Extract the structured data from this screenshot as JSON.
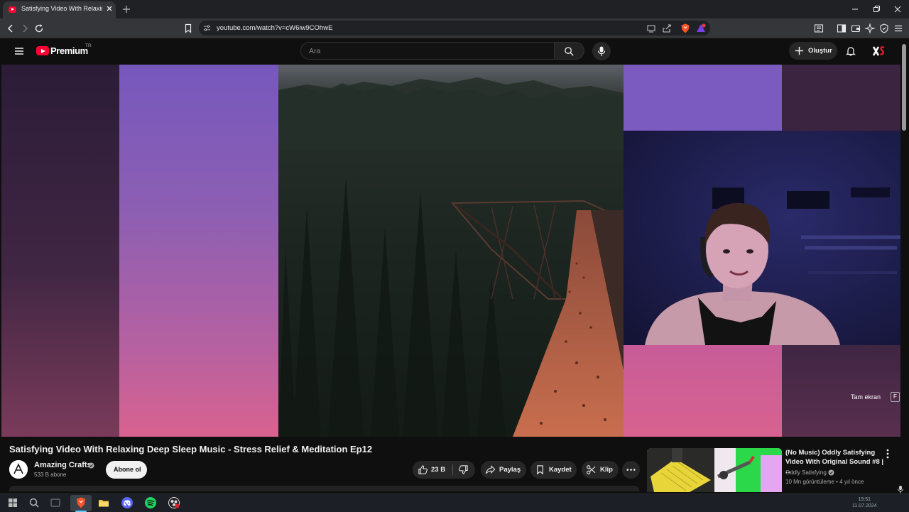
{
  "browser": {
    "tab_title": "Satisfying Video With Relaxing D",
    "url": "youtube.com/watch?v=cW6iw9COhwE"
  },
  "youtube": {
    "logo_text": "Premium",
    "logo_country": "TR",
    "search_placeholder": "Ara",
    "create_label": "Oluştur"
  },
  "player": {
    "fullscreen_label": "Tam ekran",
    "fullscreen_key": "F"
  },
  "video": {
    "title": "Satisfying Video With Relaxing Deep Sleep Music - Stress Relief & Meditation Ep12",
    "channel": "Amazing Crafts",
    "subscribers": "533 B abone",
    "subscribe_label": "Abone ol",
    "likes": "23 B",
    "share_label": "Paylaş",
    "save_label": "Kaydet",
    "clip_label": "Klip"
  },
  "recommendation": {
    "title": "(No Music) Oddly Satisfying Video With Original Sound #8 | ...",
    "channel": "Oddly Satisfying",
    "meta": "10 Mn görüntüleme • 4 yıl önce"
  },
  "taskbar": {
    "time": "19:51",
    "date": "11.07.2024"
  },
  "colors": {
    "brand_red": "#ff0033",
    "panel_purple": "#7b5bbf",
    "panel_pink": "#d8628f"
  }
}
